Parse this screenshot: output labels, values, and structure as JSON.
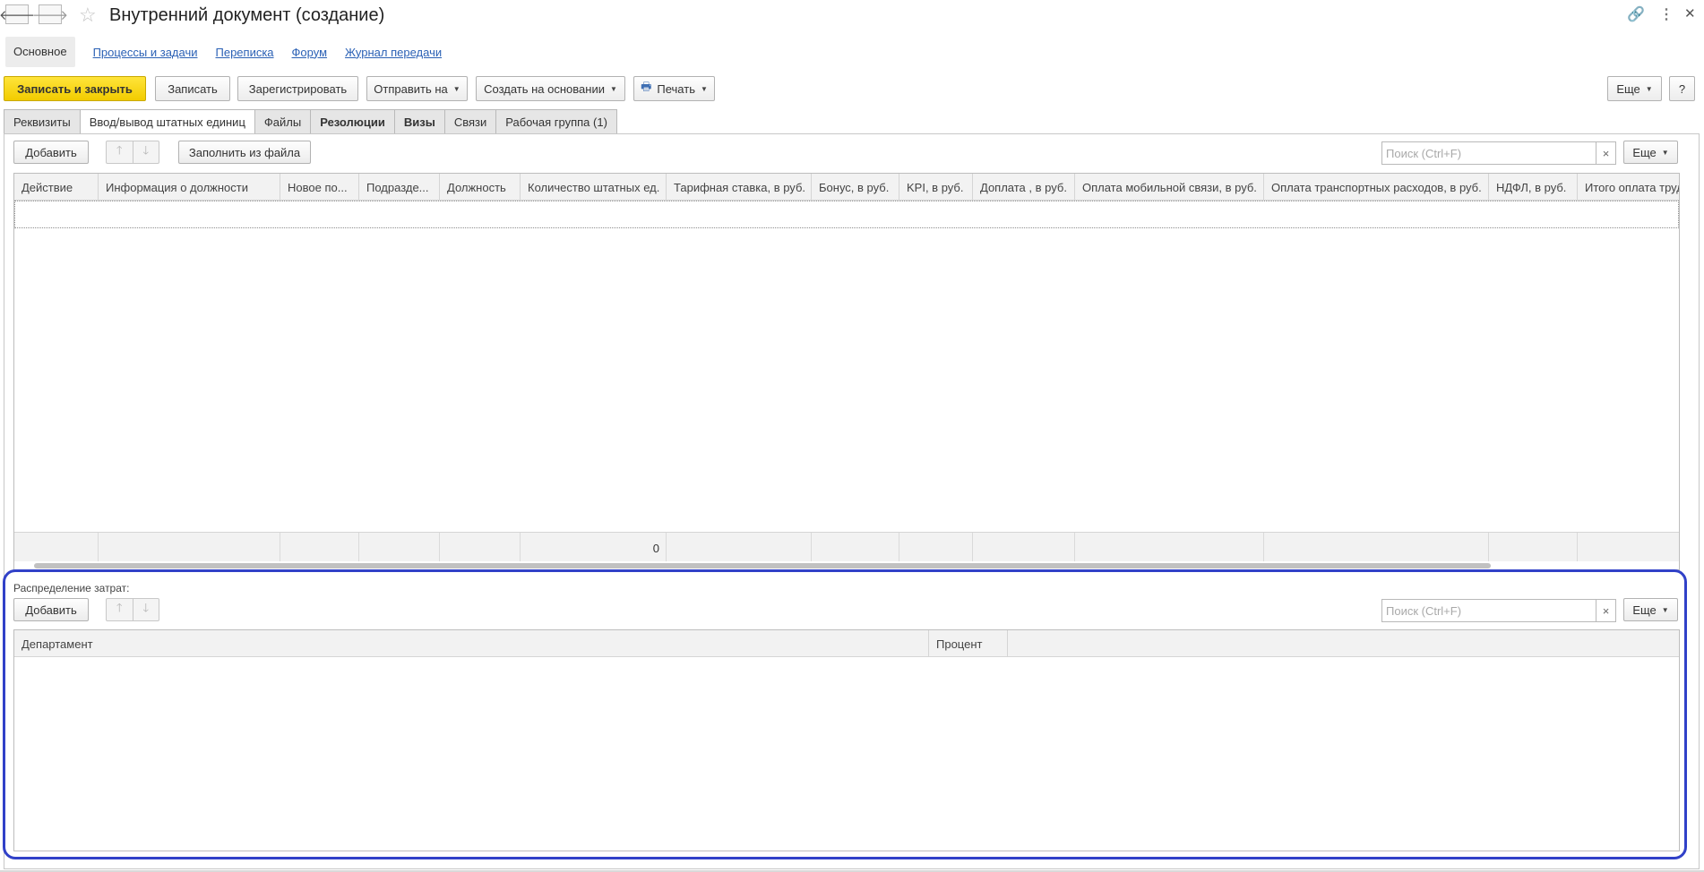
{
  "window": {
    "title": "Внутренний документ (создание)",
    "back_icon": "arrow-left-icon",
    "forward_icon": "arrow-right-icon",
    "favorite_icon": "star-icon",
    "link_icon": "link-icon",
    "menu_icon": "kebab-icon",
    "close_icon": "close-icon"
  },
  "topnav": {
    "active": "Основное",
    "links": [
      "Процессы и задачи",
      "Переписка",
      "Форум",
      "Журнал передачи"
    ]
  },
  "toolbar": {
    "save_close": "Записать и закрыть",
    "save": "Записать",
    "register": "Зарегистрировать",
    "send_to": "Отправить на",
    "create_based": "Создать на основании",
    "print": "Печать",
    "more": "Еще",
    "help": "?"
  },
  "tabs": [
    "Реквизиты",
    "Ввод/вывод штатных единиц",
    "Файлы",
    "Резолюции",
    "Визы",
    "Связи",
    "Рабочая группа (1)"
  ],
  "units_panel": {
    "add": "Добавить",
    "fill_from_file": "Заполнить из файла",
    "search_placeholder": "Поиск (Ctrl+F)",
    "clear": "×",
    "more": "Еще",
    "columns": [
      "Действие",
      "Информация о должности",
      "Новое по...",
      "Подразде...",
      "Должность",
      "Количество штатных ед.",
      "Тарифная ставка, в руб.",
      "Бонус, в руб.",
      "KPI, в руб.",
      "Доплата , в руб.",
      "Оплата мобильной связи, в руб.",
      "Оплата транспортных расходов, в руб.",
      "НДФЛ, в руб.",
      "Итого оплата труда"
    ],
    "footer_total": "0"
  },
  "cost_panel": {
    "label": "Распределение затрат:",
    "add": "Добавить",
    "search_placeholder": "Поиск (Ctrl+F)",
    "clear": "×",
    "more": "Еще",
    "columns": [
      "Департамент",
      "Процент"
    ]
  },
  "colors": {
    "primary_button": "#f2cc00",
    "link": "#2b61b5",
    "highlight": "#3141c8"
  }
}
